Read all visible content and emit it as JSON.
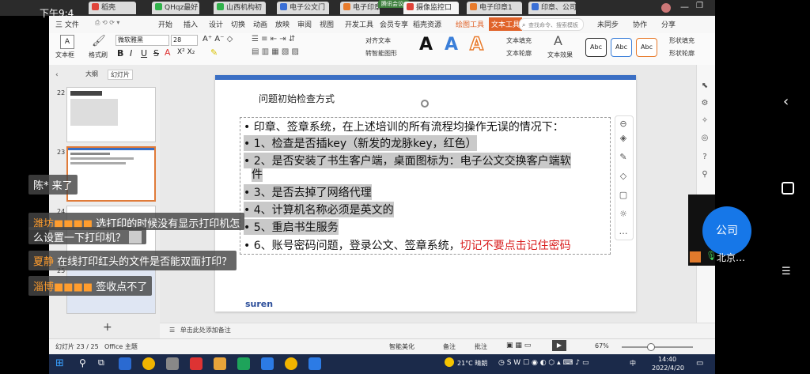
{
  "top_tabs": [
    {
      "label": "稻壳",
      "color": "#e0443a"
    },
    {
      "label": "QHqz最好",
      "color": "#31b24b"
    },
    {
      "label": "山西机构初",
      "color": "#31b24b"
    },
    {
      "label": "电子公文门",
      "color": "#3a6fd6"
    },
    {
      "label": "电子印章",
      "color": "#e87b2c"
    },
    {
      "label": "腾讯会议",
      "color": "#2b7cf6"
    },
    {
      "label": "摄像监控口",
      "color": "#e0443a"
    },
    {
      "label": "电子印章1",
      "color": "#e87b2c"
    },
    {
      "label": "印章、公司",
      "color": "#3a6fd6"
    }
  ],
  "overlay_time": "下午9:4",
  "meeting_badge": "腾讯会议",
  "menu": [
    "三 文件",
    "开始",
    "插入",
    "设计",
    "切换",
    "动画",
    "放映",
    "审阅",
    "视图",
    "开发工具",
    "会员专享",
    "稻壳资源",
    "绘图工具",
    "文本工具"
  ],
  "search_placeholder": "查找命令、搜索模板",
  "menu_right": [
    "未同步",
    "协作",
    "分享"
  ],
  "ribbon": {
    "text_box": "文本框",
    "format_painter": "格式刷",
    "font": "微软雅黑",
    "size": "28",
    "align_text": "对齐文本",
    "convert_smartart": "转智能图形",
    "text_fill": "文本填充",
    "text_outline": "文本轮廓",
    "text_effect": "文本效果",
    "styles": [
      "Abc",
      "Abc",
      "Abc"
    ],
    "shape_fill": "形状填充",
    "shape_outline": "形状轮廓",
    "bold": "B",
    "italic": "I",
    "underline": "U",
    "strike": "S"
  },
  "panel_tabs": [
    "大纲",
    "幻灯片"
  ],
  "thumbnails": [
    {
      "num": "22"
    },
    {
      "num": "23"
    },
    {
      "num": "24"
    },
    {
      "num": "25"
    }
  ],
  "add_slide": "+",
  "slide": {
    "title": "问题初始检查方式",
    "lines": [
      {
        "text": "• 印章、签章系统，在上述培训的所有流程均操作无误的情况下：",
        "hl": false
      },
      {
        "text": "• 1、检查是否插key（新发的龙脉key，红色）",
        "hl": true
      },
      {
        "text": "• 2、是否安装了书生客户端，桌面图标为：电子公文交换客户端软",
        "hl": true
      },
      {
        "text": "件",
        "hl": true
      },
      {
        "text": "• 3、是否去掉了网络代理",
        "hl": true
      },
      {
        "text": "• 4、计算机名称必须是英文的",
        "hl": true
      },
      {
        "text": "• 5、重启书生服务",
        "hl": true
      }
    ],
    "last_line_prefix": "• 6、账号密码问题，登录公文、签章系统，",
    "last_line_red": "切记不要点击记住密码",
    "logo": "suren"
  },
  "notes_placeholder": "单击此处添加备注",
  "status": {
    "slide_count": "幻灯片 23 / 25",
    "theme": "Office 主题",
    "smart_beautify": "智能美化",
    "notes": "备注",
    "comments": "批注",
    "zoom": "67%"
  },
  "taskbar": {
    "weather": "21°C 晴朗",
    "ime": "中",
    "time": "14:40",
    "date": "2022/4/20"
  },
  "company_label": "公司",
  "speaker": "北京…",
  "chats": [
    {
      "name": "陈*",
      "msg": "来了"
    },
    {
      "name": "潍坊■■■■",
      "msg": "选打印的时候没有显示打印机怎"
    },
    {
      "name": "",
      "msg": "么设置一下打印机？"
    },
    {
      "name": "夏静",
      "msg": "在线打印红头的文件是否能双面打印？"
    },
    {
      "name": "淄博■■■■",
      "msg": "签收点不了"
    }
  ]
}
